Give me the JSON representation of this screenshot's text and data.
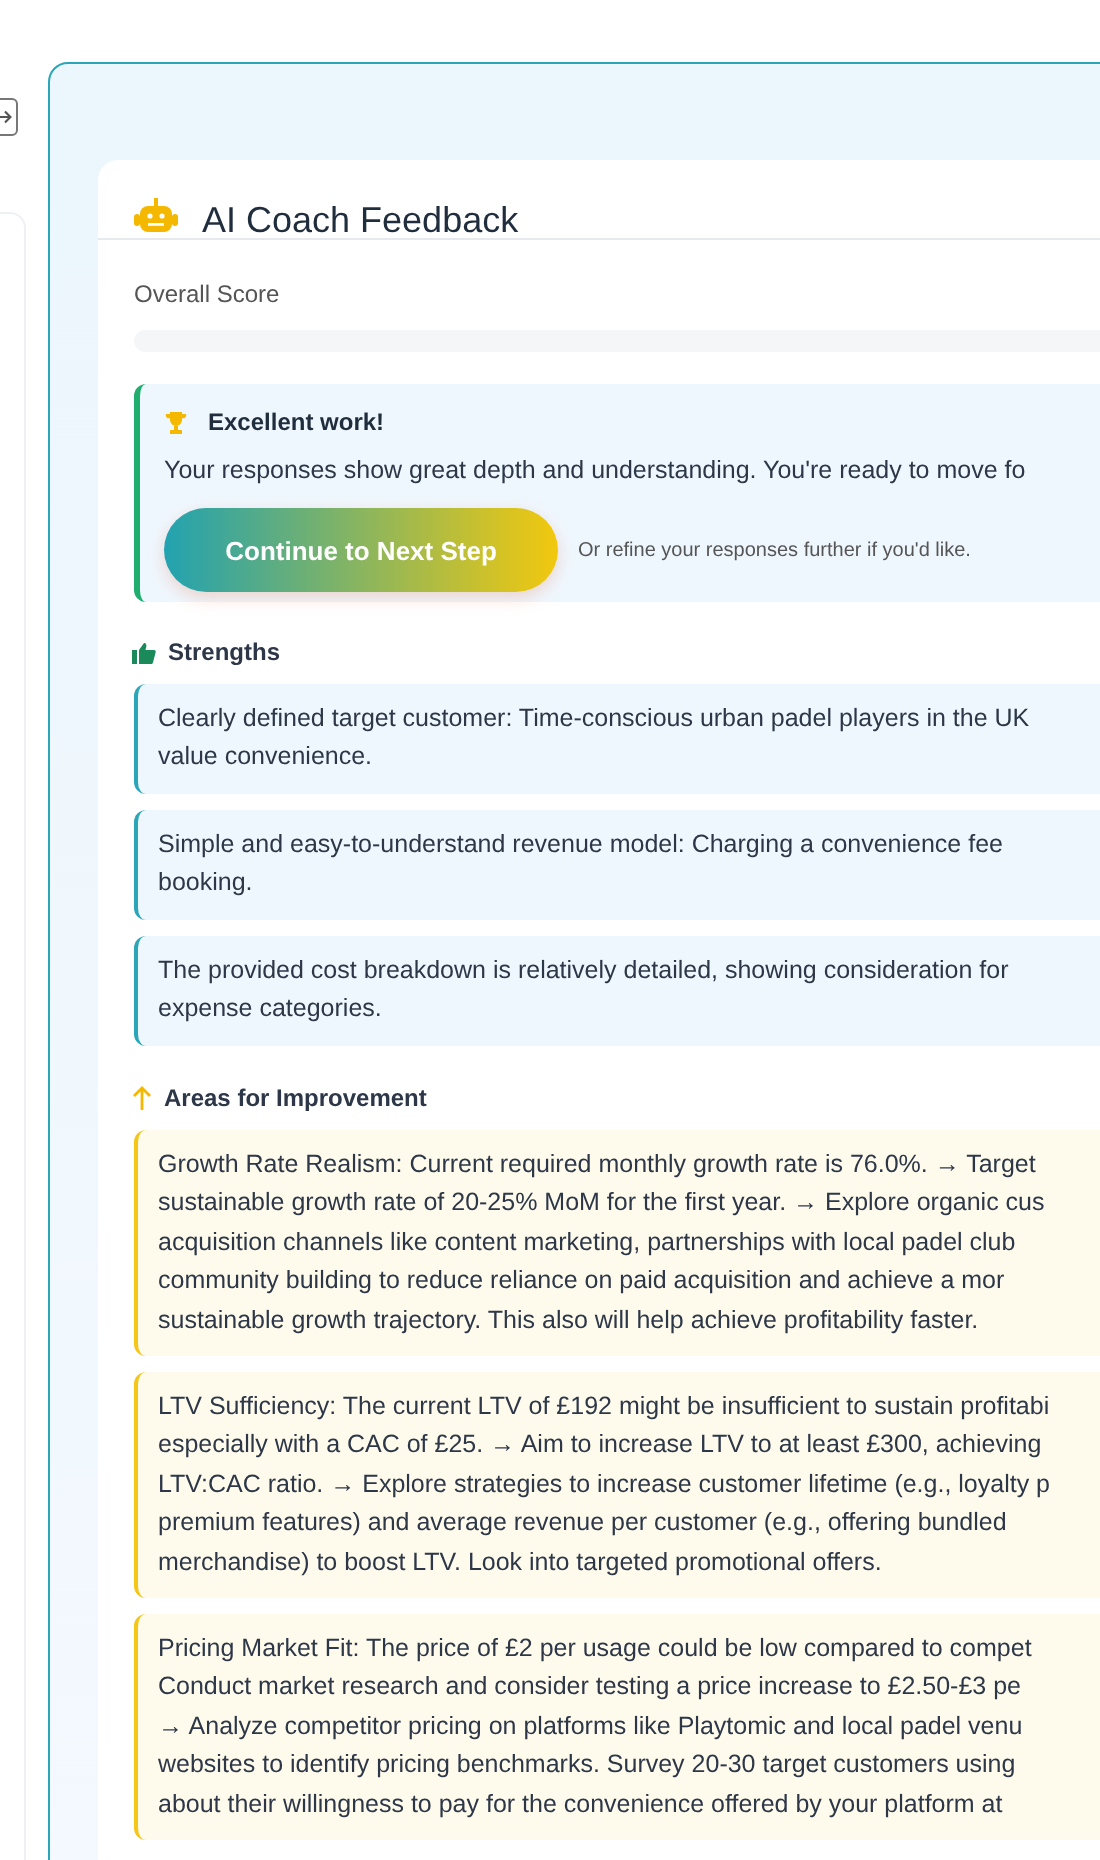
{
  "panel": {
    "title": "AI Coach Feedback",
    "score": {
      "label": "Overall Score",
      "level": 0
    }
  },
  "banner": {
    "title": "Excellent work!",
    "message": "Your responses show great depth and understanding. You're ready to move fo",
    "button": "Continue to Next Step",
    "hint": "Or refine your responses further if you'd like."
  },
  "strengths": {
    "title": "Strengths",
    "items": [
      {
        "lines": [
          "Clearly defined target customer: Time-conscious urban padel players in the UK",
          "value convenience."
        ]
      },
      {
        "lines": [
          "Simple and easy-to-understand revenue model: Charging a convenience fee",
          "booking."
        ]
      },
      {
        "lines": [
          "The provided cost breakdown is relatively detailed, showing consideration for",
          "expense categories."
        ]
      }
    ]
  },
  "improvements": {
    "title": "Areas for Improvement",
    "items": [
      {
        "lines": [
          "Growth Rate Realism: Current required monthly growth rate is 76.0%. → Target",
          "sustainable growth rate of 20-25% MoM for the first year. → Explore organic cus",
          "acquisition channels like content marketing, partnerships with local padel club",
          "community building to reduce reliance on paid acquisition and achieve a mor",
          "sustainable growth trajectory. This also will help achieve profitability faster."
        ]
      },
      {
        "lines": [
          "LTV Sufficiency: The current LTV of £192 might be insufficient to sustain profitabi",
          "especially with a CAC of £25. → Aim to increase LTV to at least £300, achieving",
          "LTV:CAC ratio. → Explore strategies to increase customer lifetime (e.g., loyalty p",
          "premium features) and average revenue per customer (e.g., offering bundled",
          "merchandise) to boost LTV. Look into targeted promotional offers."
        ]
      },
      {
        "lines": [
          "Pricing Market Fit: The price of £2 per usage could be low compared to compet",
          "Conduct market research and consider testing a price increase to £2.50-£3 pe",
          "→ Analyze competitor pricing on platforms like Playtomic and local padel venu",
          "websites to identify pricing benchmarks. Survey 20-30 target customers using",
          "about their willingness to pay for the convenience offered by your platform at"
        ]
      }
    ]
  }
}
